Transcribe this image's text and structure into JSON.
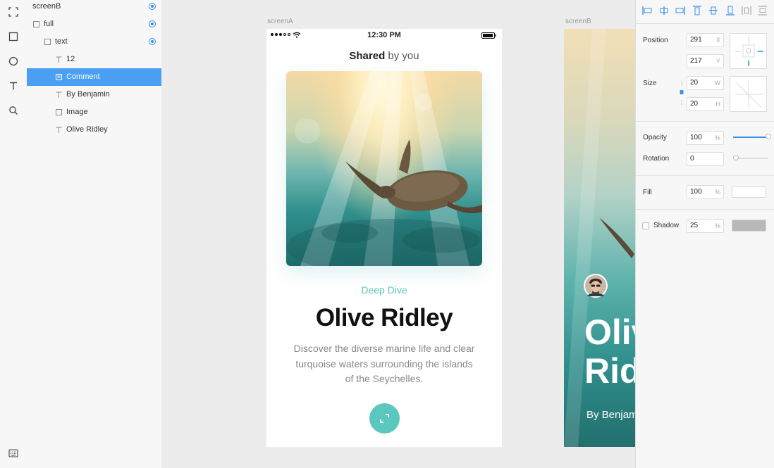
{
  "layers": [
    {
      "name": "screenB",
      "type": "group",
      "visible": true
    },
    {
      "name": "full",
      "type": "group",
      "visible": true
    },
    {
      "name": "text",
      "type": "group",
      "visible": true
    },
    {
      "name": "12",
      "type": "text",
      "visible": false
    },
    {
      "name": "Comment",
      "type": "symbol",
      "visible": false,
      "selected": true
    },
    {
      "name": "By Benjamin",
      "type": "text",
      "visible": false
    },
    {
      "name": "Image",
      "type": "rect",
      "visible": false
    },
    {
      "name": "Olive Ridley",
      "type": "text",
      "visible": false
    }
  ],
  "artboards": {
    "a_label": "screenA",
    "b_label": "screenB"
  },
  "phone": {
    "time": "12:30 PM",
    "header_bold": "Shared",
    "header_rest": " by you",
    "category": "Deep Dive",
    "title": "Olive Ridley",
    "description": "Discover the diverse marine life and clear turquoise waters surrounding the islands of the Seychelles."
  },
  "screenB": {
    "title": "Olive Ridley",
    "byline": "By Benjamin"
  },
  "inspector": {
    "position_label": "Position",
    "x": "291",
    "x_unit": "X",
    "y": "217",
    "y_unit": "Y",
    "size_label": "Size",
    "w": "20",
    "w_unit": "W",
    "h": "20",
    "h_unit": "H",
    "opacity_label": "Opacity",
    "opacity": "100",
    "opacity_unit": "%",
    "opacity_level": 1.0,
    "rotation_label": "Rotation",
    "rotation": "0",
    "fill_label": "Fill",
    "fill": "100",
    "fill_unit": "%",
    "shadow_label": "Shadow",
    "shadow": "25",
    "shadow_unit": "%",
    "shadow_enabled": false
  },
  "colors": {
    "accent": "#4a9ff2",
    "teal": "#5ac8be",
    "fill_swatch": "#ffffff",
    "shadow_swatch": "#b8b8b8"
  }
}
